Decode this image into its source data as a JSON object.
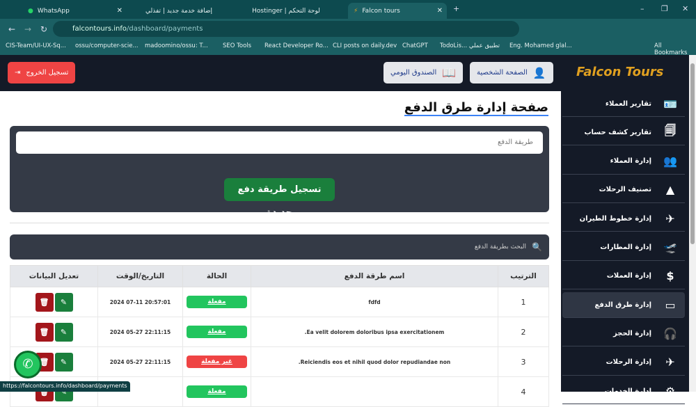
{
  "browser": {
    "tabs": [
      {
        "label": "WhatsApp"
      },
      {
        "label": "إضافة خدمة جديد | تفذلي"
      },
      {
        "label": "Hostinger | لوحة التحكم"
      },
      {
        "label": "Falcon tours"
      }
    ],
    "url_host": "falcontours.info",
    "url_path": "/dashboard/payments",
    "bookmarks": [
      "CIS-Team/UI-UX-Sq...",
      "ossu/computer-scie...",
      "madoomino/ossu: T...",
      "SEO Tools",
      "React Developer Ro...",
      "CLI posts on daily.dev",
      "ChatGPT",
      "TodoLis... تطبيق عملي",
      "Eng. Mohamed glal..."
    ],
    "all_bookmarks": "All Bookmarks",
    "status_url": "https://falcontours.info/dashboard/payments"
  },
  "header": {
    "logout": "تسجيل الخروج",
    "daily_box": "الصندوق اليومي",
    "profile": "الصفحة الشخصية",
    "logo": "Falcon Tours"
  },
  "sidebar": {
    "items": [
      {
        "label": "تقارير العملاء",
        "icon": "🪪"
      },
      {
        "label": "تقارير كشف حساب",
        "icon": "🗐"
      },
      {
        "label": "إدارة العملاء",
        "icon": "👥"
      },
      {
        "label": "تصنيف الرحلات",
        "icon": "▲"
      },
      {
        "label": "إدارة خطوط الطيران",
        "icon": "✈"
      },
      {
        "label": "إدارة المطارات",
        "icon": "🛫"
      },
      {
        "label": "إدارة العملات",
        "icon": "$"
      },
      {
        "label": "إدارة طرق الدفع",
        "icon": "▭"
      },
      {
        "label": "إدارة الحجز",
        "icon": "🎧"
      },
      {
        "label": "إدارة الرحلات",
        "icon": "✈"
      },
      {
        "label": "إدارة الخدمات",
        "icon": "⚙"
      }
    ]
  },
  "main": {
    "title": "صفحة إدارة طرق الدفع",
    "input_placeholder": "طريقة الدفع",
    "submit": "تسجيل طريقة دفع جديدة",
    "search_placeholder": "البحث بطريقة الدفع",
    "columns": [
      "الترتيب",
      "اسم طرقة الدفع",
      "الحالة",
      "التاريخ/الوقت",
      "تعديل البيانات"
    ],
    "rows": [
      {
        "num": "1",
        "name": "fdfd",
        "status": "مفعلة",
        "active": true,
        "date": "20:57:01 07-11 2024"
      },
      {
        "num": "2",
        "name": "Ea velit dolorem doloribus ipsa exercitationem.",
        "status": "مفعلة",
        "active": true,
        "date": "22:11:15 05-27 2024"
      },
      {
        "num": "3",
        "name": "Reiciendis eos et nihil quod dolor repudiandae non.",
        "status": "غير مفعلة",
        "active": false,
        "date": "22:11:15 05-27 2024"
      },
      {
        "num": "4",
        "name": "",
        "status": "مفعلة",
        "active": true,
        "date": ""
      }
    ]
  },
  "colors": {
    "active": "#22c55e",
    "inactive": "#ef4444",
    "sidebar": "#141a27",
    "accent": "#e0a020"
  }
}
